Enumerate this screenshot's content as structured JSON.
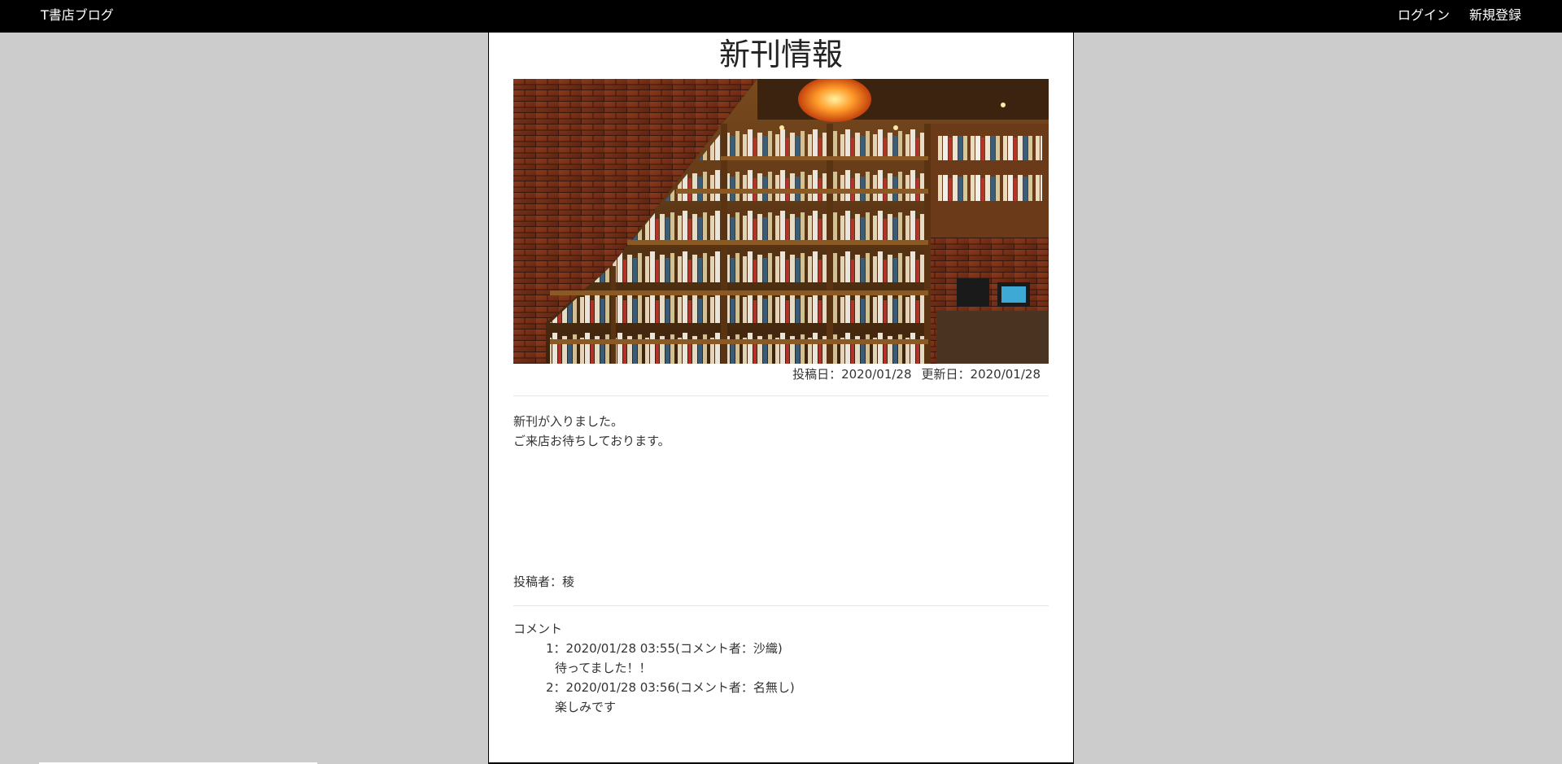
{
  "navbar": {
    "brand": "T書店ブログ",
    "links": [
      {
        "label": "ログイン"
      },
      {
        "label": "新規登録"
      }
    ]
  },
  "post": {
    "title": "新刊情報",
    "image_alt": "bookstore-shelves-photo",
    "dates": {
      "posted": "投稿日：2020/01/28",
      "updated": "更新日：2020/01/28"
    },
    "body_lines": [
      "新刊が入りました。",
      "ご来店お待ちしております。"
    ],
    "author": "投稿者：稜"
  },
  "comments": {
    "heading": "コメント",
    "items": [
      {
        "meta": "1：2020/01/28 03:55(コメント者：沙織)",
        "text": "待ってました！！"
      },
      {
        "meta": "2：2020/01/28 03:56(コメント者：名無し)",
        "text": "楽しみです"
      }
    ]
  },
  "colors": {
    "navbar_bg": "#000000",
    "page_bg": "#cccccc",
    "panel_bg": "#ffffff"
  }
}
